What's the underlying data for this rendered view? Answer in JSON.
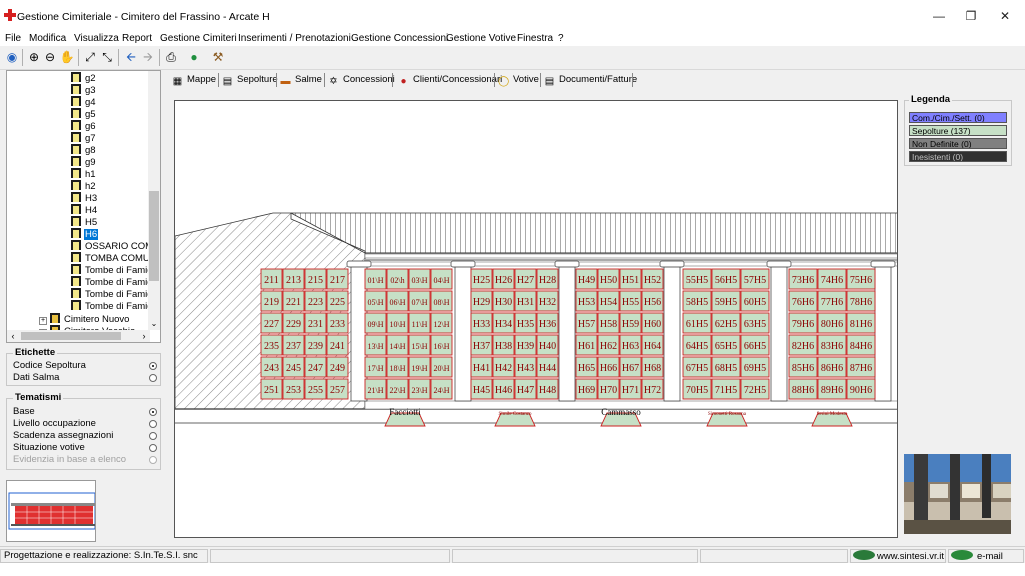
{
  "window": {
    "title": "Gestione Cimiteriale - Cimitero del Frassino - Arcate H"
  },
  "menu": [
    "File",
    "Modifica",
    "Visualizza",
    "Report",
    "Gestione Cimiteri",
    "Inserimenti / Prenotazioni",
    "Gestione Concessioni",
    "Gestione Votive",
    "Finestra",
    "?"
  ],
  "tree": {
    "items": [
      "g2",
      "g3",
      "g4",
      "g5",
      "g6",
      "g7",
      "g8",
      "g9",
      "h1",
      "h2",
      "H3",
      "H4",
      "H5",
      "H6",
      "OSSARIO COMUN",
      "TOMBA COMUNA",
      "Tombe di Famiglia",
      "Tombe di Famiglia",
      "Tombe di Famiglia",
      "Tombe di Famiglia"
    ],
    "selected": "H6",
    "cimitero_nuovo": "Cimitero Nuovo",
    "cimitero_vecchio": "Cimitero Vecchio"
  },
  "etichette": {
    "title": "Etichette",
    "options": [
      {
        "label": "Codice Sepoltura",
        "selected": true
      },
      {
        "label": "Dati Salma",
        "selected": false
      }
    ]
  },
  "tematismi": {
    "title": "Tematismi",
    "options": [
      {
        "label": "Base",
        "selected": true,
        "enabled": true
      },
      {
        "label": "Livello occupazione",
        "selected": false,
        "enabled": true
      },
      {
        "label": "Scadenza assegnazioni",
        "selected": false,
        "enabled": true
      },
      {
        "label": "Situazione votive",
        "selected": false,
        "enabled": true
      },
      {
        "label": "Evidenzia in base a elenco",
        "selected": false,
        "enabled": false
      }
    ]
  },
  "tabs": [
    "Mappe",
    "Sepolture",
    "Salme",
    "Concessioni",
    "Clienti/Concessionari",
    "Votive",
    "Documenti/Fatture"
  ],
  "active_tab": "Mappe",
  "legend": {
    "title": "Legenda",
    "items": [
      {
        "label": "Com./Cim./Sett. (0)",
        "color": "#8080ff",
        "text_color": "#000000"
      },
      {
        "label": "Sepolture (137)",
        "color": "#c6e0c6",
        "text_color": "#000000"
      },
      {
        "label": "Non Definite (0)",
        "color": "#808080",
        "text_color": "#000000"
      },
      {
        "label": "Inesistenti (0)",
        "color": "#303030",
        "text_color": "#c0c0c0"
      }
    ]
  },
  "map": {
    "cell_fill": "#c6e0c6",
    "cell_stroke": "#cc2222",
    "label_color": "#8b0000",
    "bays": [
      {
        "rows": [
          [
            "211",
            "213",
            "215",
            "217"
          ],
          [
            "219",
            "221",
            "223",
            "225"
          ],
          [
            "227",
            "229",
            "231",
            "233"
          ],
          [
            "235",
            "237",
            "239",
            "241"
          ],
          [
            "243",
            "245",
            "247",
            "249"
          ],
          [
            "251",
            "253",
            "255",
            "257"
          ]
        ]
      },
      {
        "rows": [
          [
            "01\\H",
            "02\\h",
            "03\\H",
            "04\\H"
          ],
          [
            "05\\H",
            "06\\H",
            "07\\H",
            "08\\H"
          ],
          [
            "09\\H",
            "10\\H",
            "11\\H",
            "12\\H"
          ],
          [
            "13\\H",
            "14\\H",
            "15\\H",
            "16\\H"
          ],
          [
            "17\\H",
            "18\\H",
            "19\\H",
            "20\\H"
          ],
          [
            "21\\H",
            "22\\H",
            "23\\H",
            "24\\H"
          ]
        ]
      },
      {
        "rows": [
          [
            "H25",
            "H26",
            "H27",
            "H28"
          ],
          [
            "H29",
            "H30",
            "H31",
            "H32"
          ],
          [
            "H33",
            "H34",
            "H35",
            "H36"
          ],
          [
            "H37",
            "H38",
            "H39",
            "H40"
          ],
          [
            "H41",
            "H42",
            "H43",
            "H44"
          ],
          [
            "H45",
            "H46",
            "H47",
            "H48"
          ]
        ]
      },
      {
        "rows": [
          [
            "H49",
            "H50",
            "H51",
            "H52"
          ],
          [
            "H53",
            "H54",
            "H55",
            "H56"
          ],
          [
            "H57",
            "H58",
            "H59",
            "H60"
          ],
          [
            "H61",
            "H62",
            "H63",
            "H64"
          ],
          [
            "H65",
            "H66",
            "H67",
            "H68"
          ],
          [
            "H69",
            "H70",
            "H71",
            "H72"
          ]
        ]
      },
      {
        "rows": [
          [
            "55H5",
            "56H5",
            "57H5"
          ],
          [
            "58H5",
            "59H5",
            "60H5"
          ],
          [
            "61H5",
            "62H5",
            "63H5"
          ],
          [
            "64H5",
            "65H5",
            "66H5"
          ],
          [
            "67H5",
            "68H5",
            "69H5"
          ],
          [
            "70H5",
            "71H5",
            "72H5"
          ]
        ]
      },
      {
        "rows": [
          [
            "73H6",
            "74H6",
            "75H6"
          ],
          [
            "76H6",
            "77H6",
            "78H6"
          ],
          [
            "79H6",
            "80H6",
            "81H6"
          ],
          [
            "82H6",
            "83H6",
            "84H6"
          ],
          [
            "85H6",
            "86H6",
            "87H6"
          ],
          [
            "88H6",
            "89H6",
            "90H6"
          ]
        ]
      }
    ],
    "bottom_labels": [
      "Facciotti",
      "Simile Costanzo",
      "Cammasso",
      "Simonetti Rosanna",
      "Serini Modesto"
    ]
  },
  "status": {
    "credits": "Progettazione e realizzazione: S.In.Te.S.I. snc",
    "website": "www.sintesi.vr.it",
    "email": "e-mail"
  }
}
